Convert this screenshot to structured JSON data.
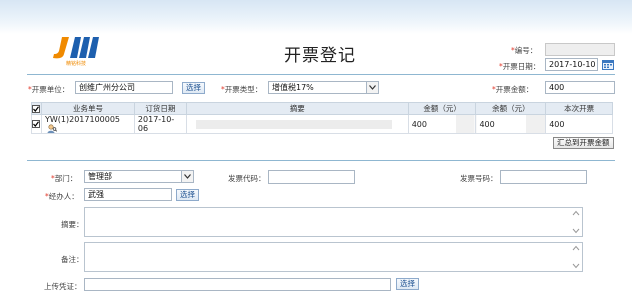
{
  "header": {
    "logo_text": "JM",
    "logo_sub": "精铭科技",
    "title": "开票登记",
    "number_label": "编号：",
    "number_value": "",
    "invoice_date_label": "开票日期：",
    "invoice_date_value": "2017-10-10",
    "calendar_icon": "calendar-icon"
  },
  "form_top": {
    "unit_label": "开票单位：",
    "unit_value": "创维广州分公司",
    "select_label": "选择",
    "type_label": "开票类型：",
    "type_value": "增值税17%",
    "amount_label": "开票金额：",
    "amount_value": "400"
  },
  "table": {
    "headers": [
      "",
      "业务单号",
      "订货日期",
      "摘要",
      "金额（元）",
      "余额（元）",
      "本次开票"
    ],
    "rows": [
      {
        "order_no": "YW(1)2017100005",
        "order_date": "2017-10-06",
        "summary": "",
        "amount": "400",
        "balance": "400",
        "this_invoice": "400"
      }
    ],
    "summarize_button": "汇总到开票金额"
  },
  "form_bottom": {
    "dept_label": "部门：",
    "dept_value": "管理部",
    "invoice_code_label": "发票代码：",
    "invoice_code_value": "",
    "invoice_no_label": "发票号码：",
    "invoice_no_value": "",
    "handler_label": "经办人：",
    "handler_value": "武强",
    "handler_select": "选择",
    "summary_label": "摘要：",
    "summary_value": "",
    "remark_label": "备注：",
    "remark_value": "",
    "upload_label": "上传凭证：",
    "upload_value": "",
    "upload_select": "选择"
  },
  "colors": {
    "accent": "#1b4f8f",
    "required": "#e23b2d",
    "divider": "#8fb7d1",
    "logo_orange": "#f08a00"
  }
}
